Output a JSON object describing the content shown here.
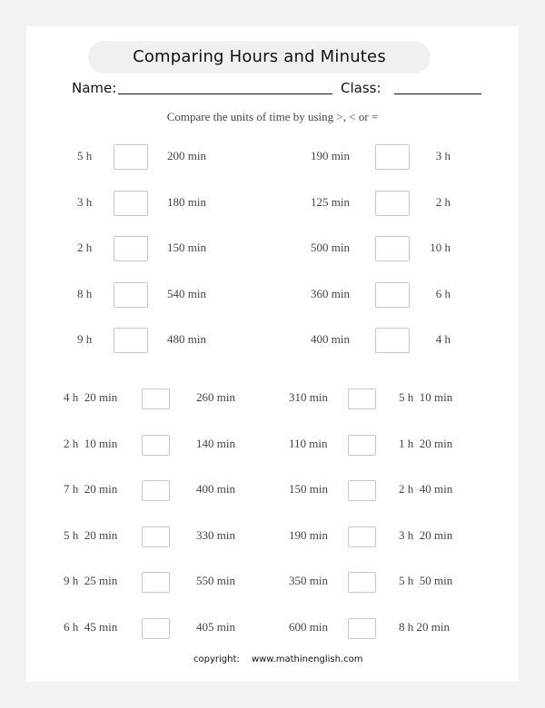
{
  "worksheet": {
    "title": "Comparing Hours and Minutes",
    "name_label": "Name:",
    "class_label": "Class:",
    "instructions": "Compare the units of time by using >, < or =",
    "section1": {
      "left": [
        {
          "a": "5 h",
          "b": "200 min",
          "answer": ""
        },
        {
          "a": "3 h",
          "b": "180 min",
          "answer": ""
        },
        {
          "a": "2 h",
          "b": "150 min",
          "answer": ""
        },
        {
          "a": "8 h",
          "b": "540 min",
          "answer": ""
        },
        {
          "a": "9 h",
          "b": "480 min",
          "answer": ""
        }
      ],
      "right": [
        {
          "a": "190 min",
          "b": "3 h",
          "answer": ""
        },
        {
          "a": "125 min",
          "b": "2 h",
          "answer": ""
        },
        {
          "a": "500 min",
          "b": "10 h",
          "answer": ""
        },
        {
          "a": "360 min",
          "b": "6 h",
          "answer": ""
        },
        {
          "a": "400 min",
          "b": "4 h",
          "answer": ""
        }
      ]
    },
    "section2": {
      "left": [
        {
          "a": "4 h  20 min",
          "b": "260 min",
          "answer": ""
        },
        {
          "a": "2 h  10 min",
          "b": "140 min",
          "answer": ""
        },
        {
          "a": "7 h  20 min",
          "b": "400 min",
          "answer": ""
        },
        {
          "a": "5 h  20 min",
          "b": "330 min",
          "answer": ""
        },
        {
          "a": "9 h  25 min",
          "b": "550 min",
          "answer": ""
        },
        {
          "a": "6 h  45 min",
          "b": "405 min",
          "answer": ""
        }
      ],
      "right": [
        {
          "a": "310 min",
          "b": "5 h  10 min",
          "answer": ""
        },
        {
          "a": "110 min",
          "b": "1 h  20 min",
          "answer": ""
        },
        {
          "a": "150 min",
          "b": "2 h  40 min",
          "answer": ""
        },
        {
          "a": "190 min",
          "b": "3 h  20 min",
          "answer": ""
        },
        {
          "a": "350 min",
          "b": "5 h  50 min",
          "answer": ""
        },
        {
          "a": "600 min",
          "b": "8 h 20 min",
          "answer": ""
        }
      ]
    },
    "footer": {
      "copyright_label": "copyright:",
      "site": "www.mathinenglish.com"
    }
  }
}
